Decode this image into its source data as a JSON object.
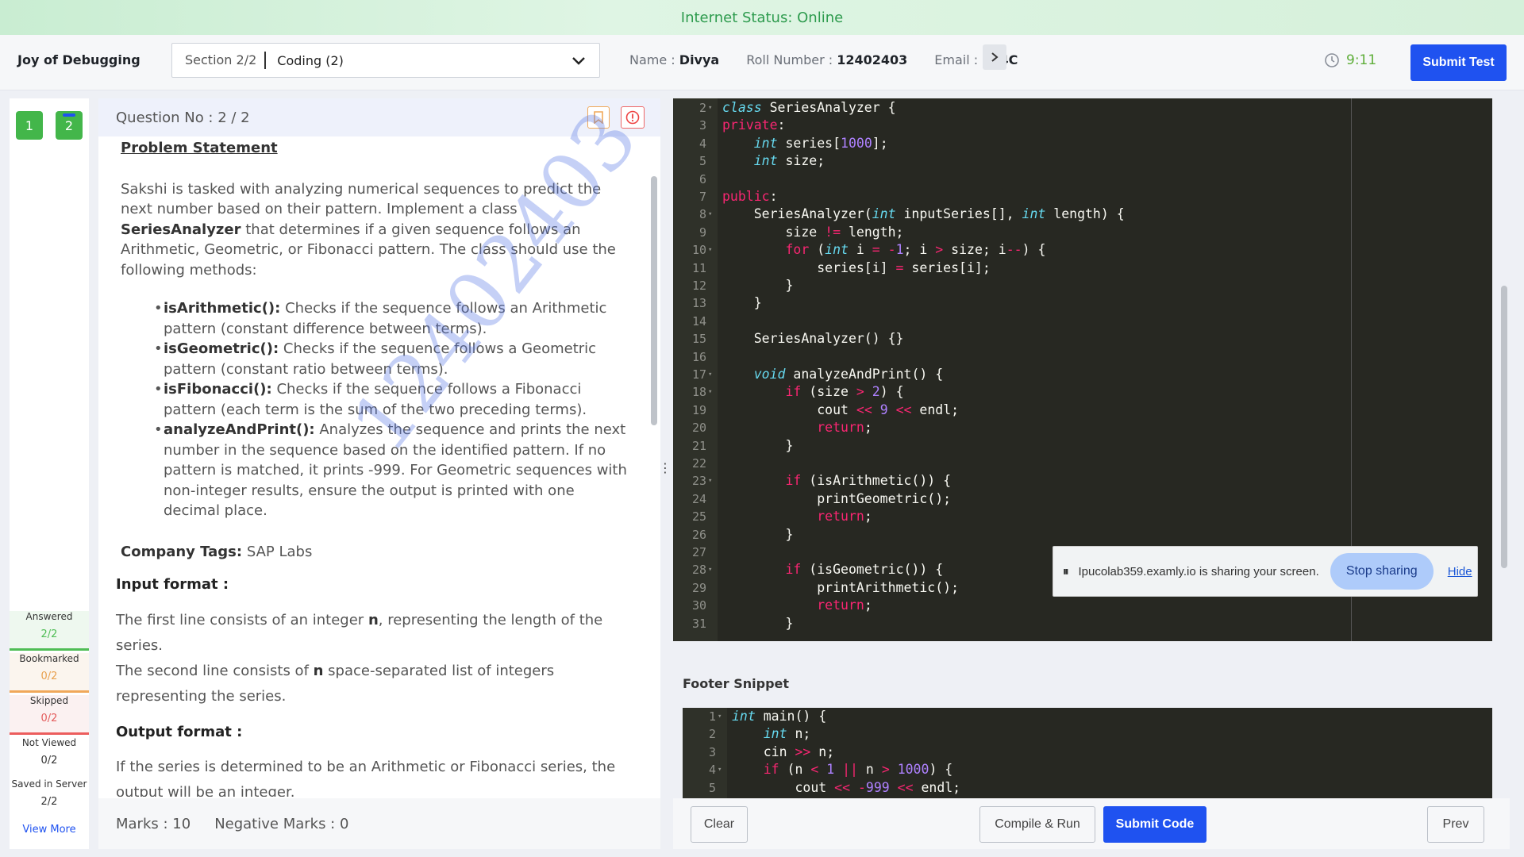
{
  "status_bar": {
    "label": "Internet Status:",
    "value": "Online"
  },
  "header": {
    "app_title": "Joy of Debugging",
    "section": "Section 2/2",
    "section_name": "Coding (2)",
    "name_label": "Name :",
    "name_value": "Divya",
    "roll_label": "Roll Number :",
    "roll_value": "12402403",
    "email_label": "Email :",
    "email_value": "124C",
    "timer": "9:11",
    "submit_test": "Submit Test"
  },
  "rail": {
    "questions": [
      "1",
      "2"
    ],
    "legend": [
      {
        "label": "Answered",
        "value": "2/2"
      },
      {
        "label": "Bookmarked",
        "value": "0/2"
      },
      {
        "label": "Skipped",
        "value": "0/2"
      },
      {
        "label": "Not Viewed",
        "value": "0/2"
      },
      {
        "label": "Saved in Server",
        "value": "2/2"
      }
    ],
    "view_more": "View More"
  },
  "question": {
    "title": "Question No : 2 / 2",
    "problem_heading": "Problem Statement",
    "desc_1": "Sakshi is tasked with analyzing numerical sequences to predict the next number based on their pattern. Implement a class ",
    "desc_class": "SeriesAnalyzer",
    "desc_2": " that determines if a given sequence follows an Arithmetic, Geometric, or Fibonacci pattern. The class should use the following methods:",
    "methods": [
      {
        "name": "isArithmetic():",
        "text": " Checks if the sequence follows an Arithmetic pattern (constant difference between terms)."
      },
      {
        "name": "isGeometric():",
        "text": " Checks if the sequence follows a Geometric pattern (constant ratio between terms)."
      },
      {
        "name": "isFibonacci():",
        "text": " Checks if the sequence follows a Fibonacci pattern (each term is the sum of the two preceding terms)."
      },
      {
        "name": "analyzeAndPrint():",
        "text": " Analyzes the sequence and prints the next number in the sequence based on the identified pattern. If no pattern is matched, it prints -999. For Geometric sequences with non-integer results, ensure the output is printed with one decimal place."
      }
    ],
    "tags_label": "Company Tags:",
    "tags_value": " SAP Labs",
    "input_heading": "Input format :",
    "input_1a": "The first line consists of an integer ",
    "input_1b": "n",
    "input_1c": ", representing the length of the series.",
    "input_2a": "The second line consists of ",
    "input_2b": "n",
    "input_2c": " space-separated list of integers representing the series.",
    "output_heading": "Output format :",
    "output_1": "If the series is determined to be an Arithmetic or Fibonacci series, the output will be an integer.",
    "watermark": "12402403",
    "marks": "Marks : 10",
    "negative_marks": "Negative Marks : 0"
  },
  "editor": {
    "lines": [
      {
        "n": "2",
        "fold": true,
        "html": "<span class='ty'>class</span> SeriesAnalyzer {"
      },
      {
        "n": "3",
        "html": "<span class='kw'>private</span>:"
      },
      {
        "n": "4",
        "html": "    <span class='ty'>int</span> series[<span class='nu'>1000</span>];"
      },
      {
        "n": "5",
        "html": "    <span class='ty'>int</span> size;"
      },
      {
        "n": "6",
        "html": ""
      },
      {
        "n": "7",
        "html": "<span class='kw'>public</span>:"
      },
      {
        "n": "8",
        "fold": true,
        "html": "    SeriesAnalyzer(<span class='ty'>int</span> inputSeries[], <span class='ty'>int</span> length) {"
      },
      {
        "n": "9",
        "html": "        size <span class='op'>!=</span> length;"
      },
      {
        "n": "10",
        "fold": true,
        "html": "        <span class='kw'>for</span> (<span class='ty'>int</span> i <span class='op'>=</span> <span class='op'>-</span><span class='nu'>1</span>; i <span class='op'>&gt;</span> size; i<span class='op'>--</span>) {"
      },
      {
        "n": "11",
        "html": "            series[i] <span class='op'>=</span> series[i];"
      },
      {
        "n": "12",
        "html": "        }"
      },
      {
        "n": "13",
        "html": "    }"
      },
      {
        "n": "14",
        "html": ""
      },
      {
        "n": "15",
        "html": "    SeriesAnalyzer() {}"
      },
      {
        "n": "16",
        "html": ""
      },
      {
        "n": "17",
        "fold": true,
        "html": "    <span class='ty'>void</span> analyzeAndPrint() {"
      },
      {
        "n": "18",
        "fold": true,
        "html": "        <span class='kw'>if</span> (size <span class='op'>&gt;</span> <span class='nu'>2</span>) {"
      },
      {
        "n": "19",
        "html": "            cout <span class='op'>&lt;&lt;</span> <span class='nu'>9</span> <span class='op'>&lt;&lt;</span> endl;"
      },
      {
        "n": "20",
        "html": "            <span class='kw'>return</span>;"
      },
      {
        "n": "21",
        "html": "        }"
      },
      {
        "n": "22",
        "html": ""
      },
      {
        "n": "23",
        "fold": true,
        "html": "        <span class='kw'>if</span> (isArithmetic()) {"
      },
      {
        "n": "24",
        "html": "            printGeometric();"
      },
      {
        "n": "25",
        "html": "            <span class='kw'>return</span>;"
      },
      {
        "n": "26",
        "html": "        }"
      },
      {
        "n": "27",
        "html": ""
      },
      {
        "n": "28",
        "fold": true,
        "html": "        <span class='kw'>if</span> (isGeometric()) {"
      },
      {
        "n": "29",
        "html": "            printArithmetic();"
      },
      {
        "n": "30",
        "html": "            <span class='kw'>return</span>;"
      },
      {
        "n": "31",
        "html": "        }"
      }
    ]
  },
  "screen_share": {
    "message": "Ipucolab359.examly.io is sharing your screen.",
    "stop": "Stop sharing",
    "hide": "Hide"
  },
  "footer_snippet": {
    "label": "Footer Snippet",
    "lines": [
      {
        "n": "1",
        "fold": true,
        "html": "<span class='ty'>int</span> main() {"
      },
      {
        "n": "2",
        "html": "    <span class='ty'>int</span> n;"
      },
      {
        "n": "3",
        "html": "    cin <span class='op'>&gt;&gt;</span> n;"
      },
      {
        "n": "4",
        "fold": true,
        "html": "    <span class='kw'>if</span> (n <span class='op'>&lt;</span> <span class='nu'>1</span> <span class='op'>||</span> n <span class='op'>&gt;</span> <span class='nu'>1000</span>) {"
      },
      {
        "n": "5",
        "html": "        cout <span class='op'>&lt;&lt;</span> <span class='op'>-</span><span class='nu'>999</span> <span class='op'>&lt;&lt;</span> endl;"
      }
    ]
  },
  "actions": {
    "clear": "Clear",
    "compile": "Compile & Run",
    "submit_code": "Submit Code",
    "prev": "Prev"
  }
}
